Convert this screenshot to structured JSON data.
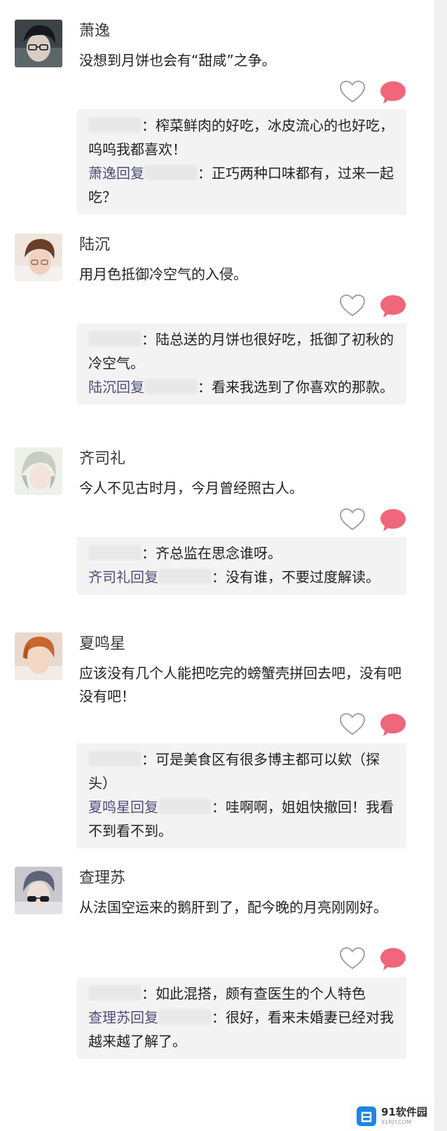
{
  "posts": [
    {
      "username": "萧逸",
      "content": "没想到月饼也会有“甜咸”之争。",
      "reply1": "：榨菜鲜肉的好吃，冰皮流心的也好吃，呜呜我都喜欢！",
      "reply2_name": "萧逸回复",
      "reply2_text": "：正巧两种口味都有，过来一起吃？",
      "avatar_icon": "avatar-glasses-dark-hair"
    },
    {
      "username": "陆沉",
      "content": "用月色抵御冷空气的入侵。",
      "reply1": "：陆总送的月饼也很好吃，抵御了初秋的冷空气。",
      "reply2_name": "陆沉回复",
      "reply2_text": "：看来我选到了你喜欢的那款。",
      "avatar_icon": "avatar-brown-hair"
    },
    {
      "username": "齐司礼",
      "content": "今人不见古时月，今月曾经照古人。",
      "reply1": "：齐总监在思念谁呀。",
      "reply2_name": "齐司礼回复",
      "reply2_text": "：没有谁，不要过度解读。",
      "avatar_icon": "avatar-silver-hair"
    },
    {
      "username": "夏鸣星",
      "content": "应该没有几个人能把吃完的螃蟹壳拼回去吧，没有吧没有吧！",
      "reply1": "：可是美食区有很多博主都可以欸（探头）",
      "reply2_name": "夏鸣星回复",
      "reply2_text": "：哇啊啊，姐姐快撤回！我看不到看不到。",
      "avatar_icon": "avatar-orange-hair"
    },
    {
      "username": "查理苏",
      "content": "从法国空运来的鹅肝到了，配今晚的月亮刚刚好。",
      "reply1": "：如此混搭，颇有查医生的个人特色",
      "reply2_name": "查理苏回复",
      "reply2_text": "：很好，看来未婚妻已经对我越来越了解了。",
      "avatar_icon": "avatar-sunglasses"
    }
  ],
  "icons": {
    "like": "heart-outline-icon",
    "comment": "comment-bubble-icon"
  },
  "colors": {
    "accent_comment": "#f0667a",
    "reply_bg": "#f3f3f3",
    "reply_name": "#4e4e7a"
  },
  "watermark": {
    "text": "91软件园",
    "sub": "91RJY.COM"
  }
}
